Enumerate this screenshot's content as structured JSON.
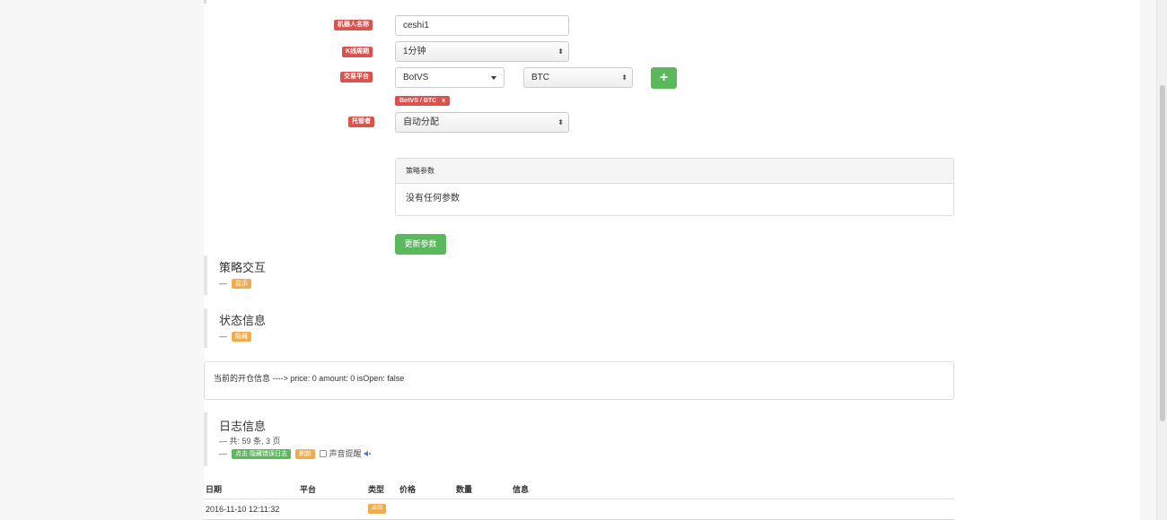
{
  "form": {
    "robot_name_label": "机器人名称",
    "robot_name_value": "ceshi1",
    "kline_label": "K线周期",
    "kline_value": "1分钟",
    "exchange_label": "交易平台",
    "exchange_value": "BotVS",
    "currency_value": "BTC",
    "exchange_tag": "BotVS / BTC",
    "exchange_tag_close": "x",
    "host_label": "托管者",
    "host_value": "自动分配"
  },
  "params_panel": {
    "title": "策略参数",
    "body": "没有任何参数"
  },
  "update_button": "更新参数",
  "interaction": {
    "title": "策略交互",
    "dash": "—",
    "toggle": "显示"
  },
  "status": {
    "title": "状态信息",
    "dash": "—",
    "toggle": "隐藏",
    "message": "当前的开仓信息 ----> price: 0 amount: 0 isOpen: false"
  },
  "logs": {
    "title": "日志信息",
    "summary": "— 共: 59 条, 3 页",
    "dash": "—",
    "hide_errors_button": "点击 隐藏错误日志",
    "refresh_button": "刷新",
    "sound_label": "声音提醒",
    "speaker_icon": "speaker-icon",
    "columns": [
      "日期",
      "平台",
      "类型",
      "价格",
      "数量",
      "信息"
    ],
    "rows": [
      {
        "date": "2016-11-10 12:11:32",
        "platform": "",
        "type": "启动",
        "price": "",
        "amount": "",
        "info": ""
      }
    ]
  },
  "colors": {
    "label_red": "#d9534f",
    "success_green": "#5cb85c",
    "warning_orange": "#f0ad4e"
  }
}
